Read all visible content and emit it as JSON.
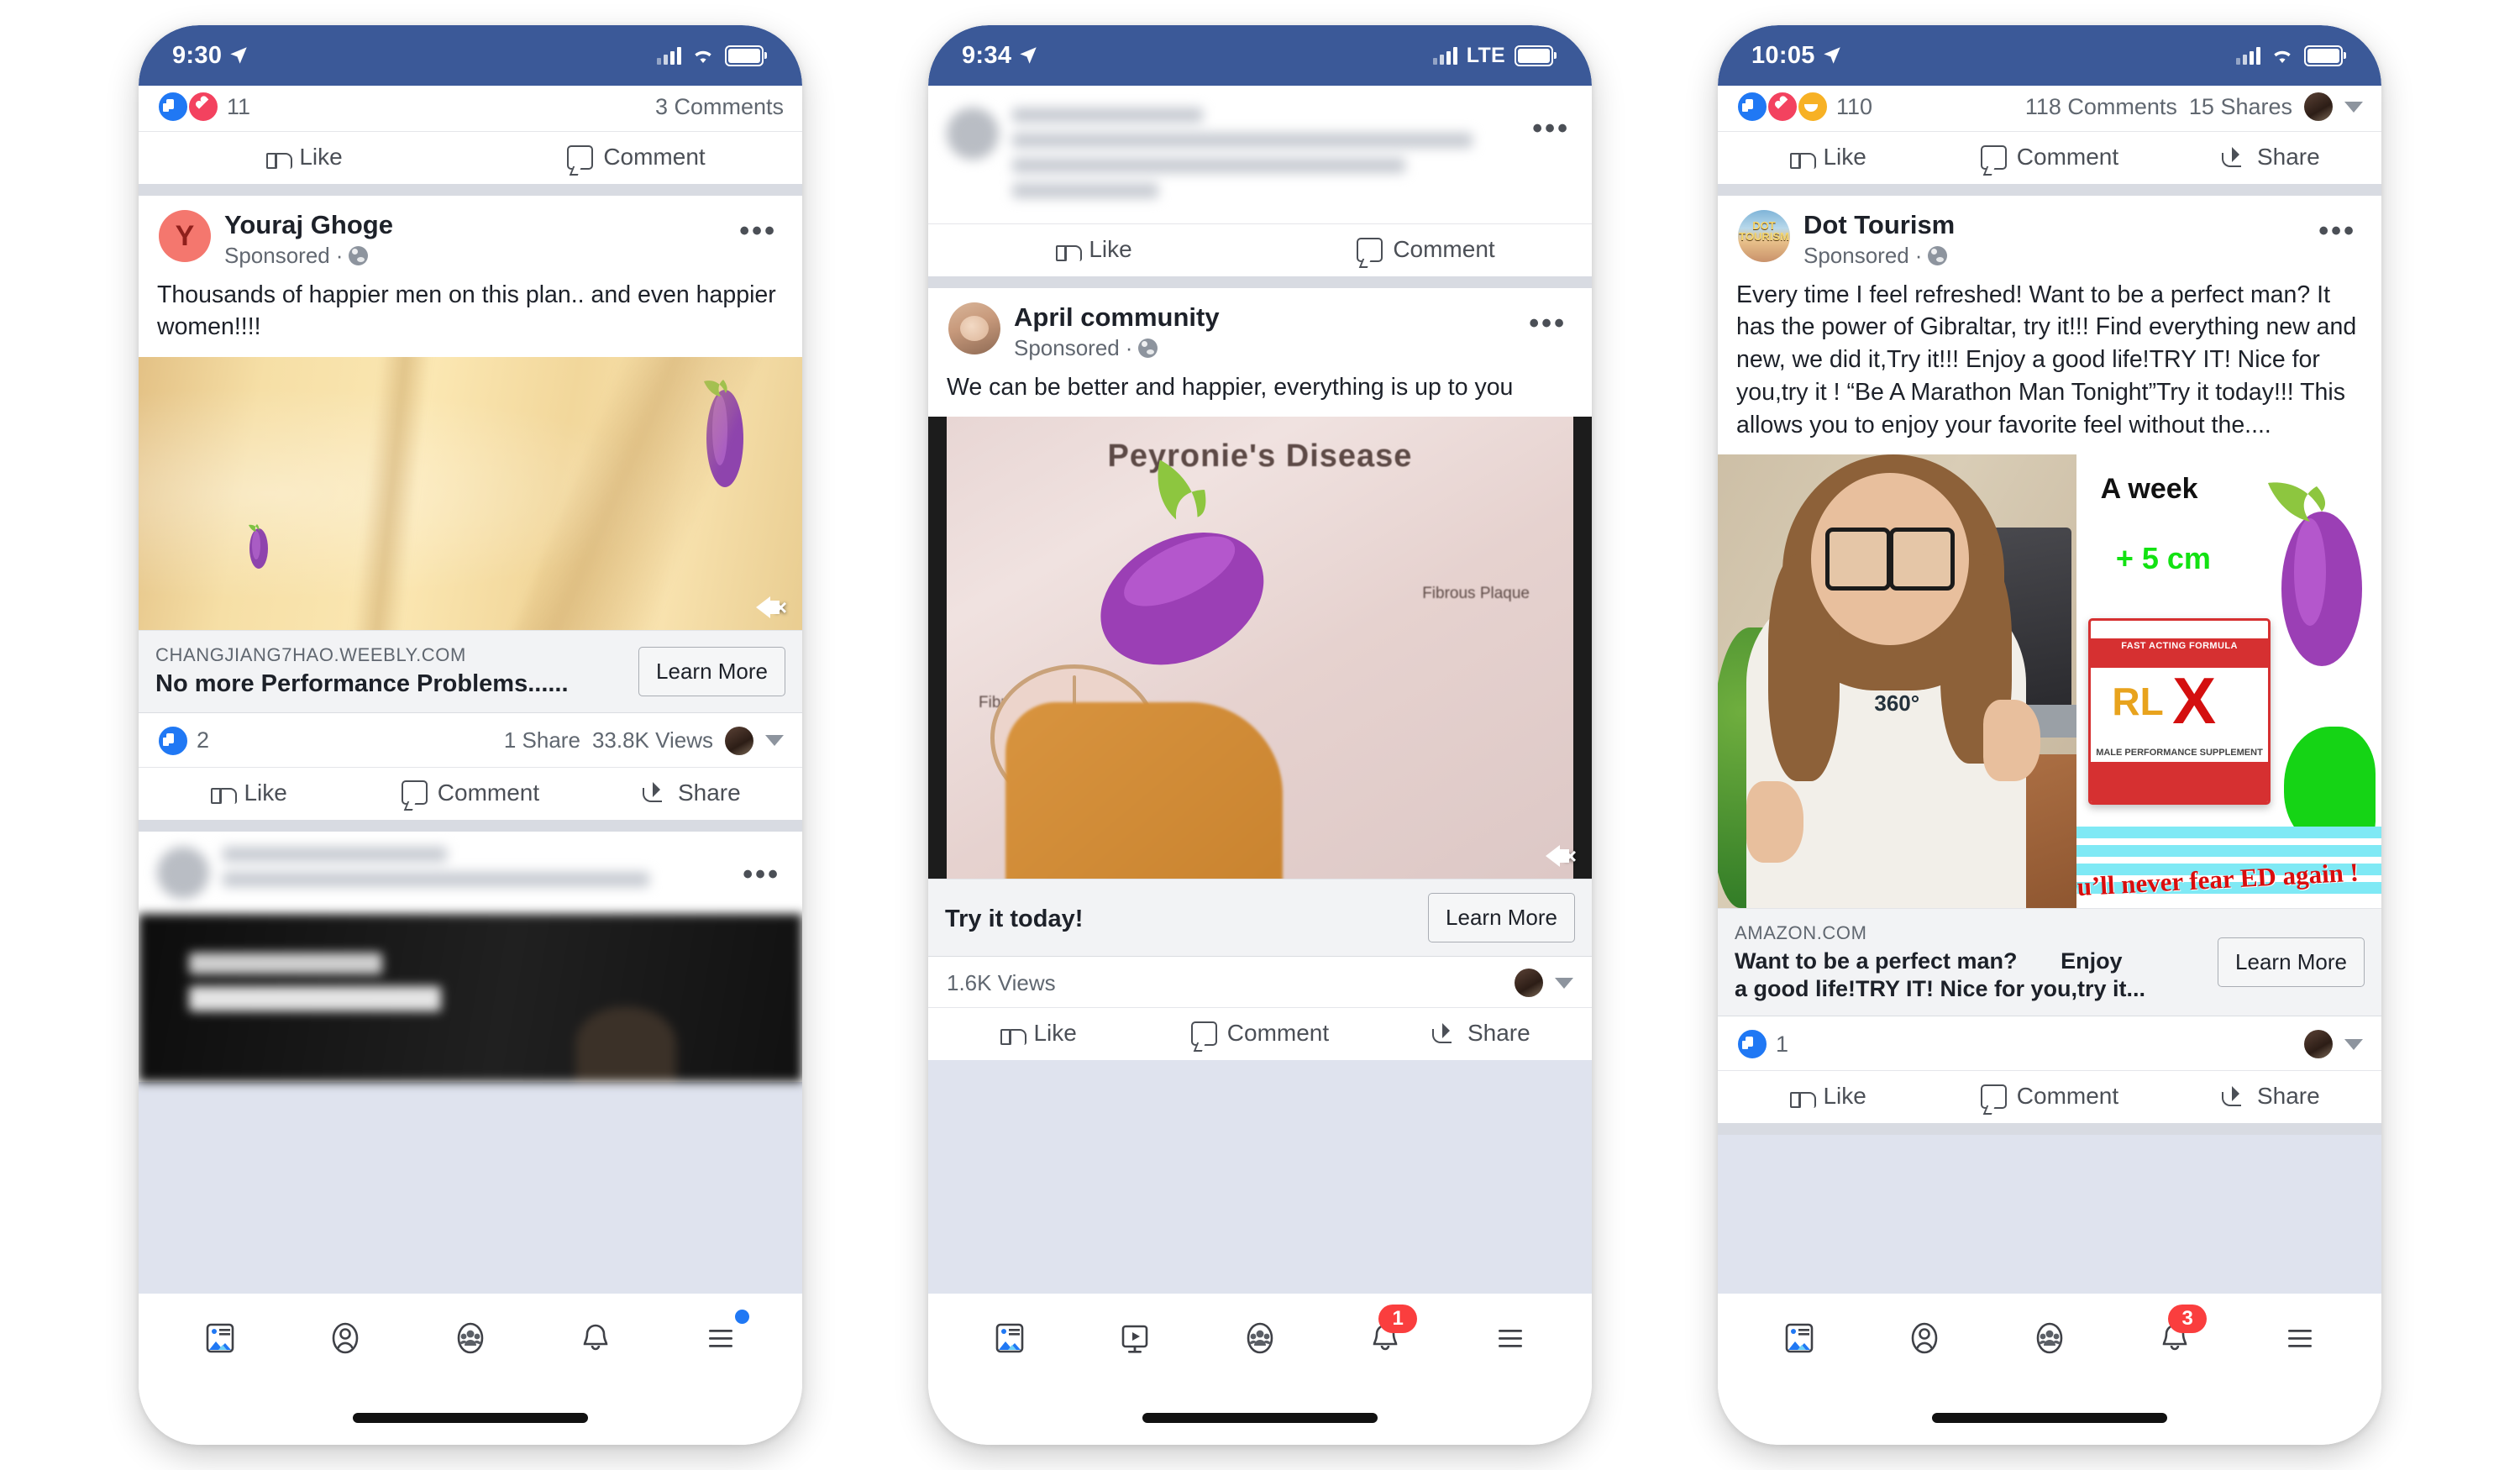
{
  "phones": [
    {
      "status": {
        "time": "9:30",
        "carrier_label": "",
        "network": "wifi"
      },
      "top_partial_post": {
        "reactions_count": "11",
        "comments": "3 Comments",
        "like": "Like",
        "comment": "Comment"
      },
      "post": {
        "author": "Youraj Ghoge",
        "avatar_letter": "Y",
        "sponsored": "Sponsored",
        "body": "Thousands of happier men on this plan.. and even happier women!!!!",
        "link_domain": "CHANGJIANG7HAO.WEEBLY.COM",
        "link_title": "No more Performance Problems......",
        "cta": "Learn More",
        "like_count": "2",
        "shares": "1 Share",
        "views": "33.8K Views",
        "actions": [
          "Like",
          "Comment",
          "Share"
        ]
      },
      "nav": {
        "items": [
          "news-feed",
          "profile",
          "groups",
          "notifications",
          "menu"
        ],
        "menu_dot": true
      }
    },
    {
      "status": {
        "time": "9:34",
        "carrier_label": "LTE",
        "network": "lte"
      },
      "top_partial_post": {
        "like": "Like",
        "comment": "Comment"
      },
      "post": {
        "author": "April community",
        "sponsored": "Sponsored",
        "body": "We can be better and happier, everything is up to you",
        "media_caption": "Peyronie's Disease",
        "media_labels": [
          "Fibrous Plaque",
          "Fibrous Plaque"
        ],
        "link_title": "Try it today!",
        "cta": "Learn More",
        "views": "1.6K Views",
        "actions": [
          "Like",
          "Comment",
          "Share"
        ]
      },
      "nav": {
        "items": [
          "news-feed",
          "watch",
          "groups",
          "notifications",
          "menu"
        ],
        "notifications_badge": "1"
      }
    },
    {
      "status": {
        "time": "10:05",
        "carrier_label": "",
        "network": "wifi"
      },
      "top_partial_post": {
        "reactions_count": "110",
        "comments": "118 Comments",
        "shares": "15 Shares",
        "actions": [
          "Like",
          "Comment",
          "Share"
        ]
      },
      "post": {
        "author": "Dot Tourism",
        "avatar_text": "DOT TOURISM",
        "sponsored": "Sponsored",
        "body": "Every time I feel refreshed! Want to be a perfect man? It has the power of Gibraltar,  try it!!! Find everything new and new, we did it,Try it!!! Enjoy a good life!TRY IT! Nice for you,try it ! “Be A Marathon Man Tonight”Try it today!!! This allows you to enjoy your favorite feel without the....",
        "image_text": {
          "headline": "A week",
          "gain": "+ 5 cm",
          "product_rl": "RL",
          "product_x": "X",
          "product_tagline": "FAST ACTING FORMULA",
          "product_sub": "MALE PERFORMANCE SUPPLEMENT",
          "banner": "ou’ll never fear ED again !"
        },
        "link_domain": "AMAZON.COM",
        "link_title_line1": "Want to be a perfect man?",
        "link_title_line1b": "Enjoy",
        "link_title_line2": "a good life!TRY IT! Nice for you,try it...",
        "cta": "Learn More",
        "like_count": "1",
        "actions": [
          "Like",
          "Comment",
          "Share"
        ]
      },
      "nav": {
        "items": [
          "news-feed",
          "profile",
          "groups",
          "notifications",
          "menu"
        ],
        "notifications_badge": "3"
      }
    }
  ],
  "colors": {
    "facebook_blue": "#3b5998",
    "feed_bg": "#dfe3ee",
    "like_blue": "#2078f4",
    "badge_red": "#fa3e3e"
  }
}
